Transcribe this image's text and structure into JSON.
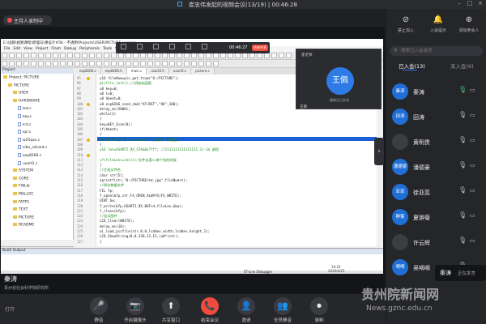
{
  "window": {
    "title": "崔忠伟发起的视频会议(13/19)  |  00:46:28"
  },
  "recording": {
    "label": "主持人录制中"
  },
  "ide": {
    "title": "E:\\试题\\视频课程\\原理与\\课设计#56 - 不透明\\Projects\\USER\\PICTURE.uvprojx",
    "menu": [
      "File",
      "Edit",
      "View",
      "Project",
      "Flash",
      "Debug",
      "Peripherals",
      "Tools",
      "SVCS",
      "Window",
      "Help"
    ],
    "project_header": "Project",
    "tree": [
      {
        "label": "Project: PICTURE",
        "kind": "folder",
        "indent": 0
      },
      {
        "label": "PICTURE",
        "kind": "folder",
        "indent": 1
      },
      {
        "label": "USER",
        "kind": "folder",
        "indent": 2
      },
      {
        "label": "HARDWARE",
        "kind": "folder",
        "indent": 2
      },
      {
        "label": "led.c",
        "kind": "file",
        "indent": 3
      },
      {
        "label": "key.c",
        "kind": "file",
        "indent": 3
      },
      {
        "label": "lcd.c",
        "kind": "file",
        "indent": 3
      },
      {
        "label": "spi.c",
        "kind": "file",
        "indent": 3
      },
      {
        "label": "w25qxx.c",
        "kind": "file",
        "indent": 3
      },
      {
        "label": "sdio_sdcard.c",
        "kind": "file",
        "indent": 3
      },
      {
        "label": "esp8266.c",
        "kind": "file",
        "indent": 3
      },
      {
        "label": "usart2.c",
        "kind": "file",
        "indent": 3
      },
      {
        "label": "SYSTEM",
        "kind": "folder",
        "indent": 2
      },
      {
        "label": "CORE",
        "kind": "folder",
        "indent": 2
      },
      {
        "label": "FWLib",
        "kind": "folder",
        "indent": 2
      },
      {
        "label": "MALLOC",
        "kind": "folder",
        "indent": 2
      },
      {
        "label": "FATFS",
        "kind": "folder",
        "indent": 2
      },
      {
        "label": "TEXT",
        "kind": "folder",
        "indent": 2
      },
      {
        "label": "PICTURE",
        "kind": "folder",
        "indent": 2
      },
      {
        "label": "README",
        "kind": "folder",
        "indent": 2
      }
    ],
    "doc_tabs": [
      "esp8266.c",
      "esp8266.h",
      "main.c",
      "usart2.h",
      "usart2.c",
      "picture.c"
    ],
    "line_numbers": [
      "95",
      "96",
      "97",
      "98",
      "99",
      "100",
      "101",
      "102",
      "103",
      "104",
      "105",
      "106",
      "107",
      "108",
      "109",
      "110",
      "111",
      "112",
      "113",
      "114",
      "115",
      "116",
      "117",
      "118",
      "119",
      "120",
      "121",
      "122",
      "123",
      "124",
      "125",
      "126",
      "127"
    ],
    "code": [
      "u16 fileNum=pic_get_tnum(\"0:/PICTURE\");",
      "picfile_init();//初始化画图",
      "u8 key=0;",
      "u8 t=0;",
      "u8 hbeat=0;",
      "u8 esp8266_send_cmd(\"AT+RST\",\"OK\",100);",
      "delay_ms(5000);",
      "while(1)",
      "{",
      "  key=KEY_Scan(0);",
      "  if(hbeat>",
      "  {",
      "    if(USART2_RX_STA&0x8000)//接收到一次数据了",
      "    {",
      "      u16 len=USART2_RX_STA&0x7fff;   //1111111111111111   3)-1Ω 调用",
      "      u32 fileLen=USART2_RX_BUF[0]<<24 | USART2_RX_BUF[1]<<16 | USART2_RX_BUF[2]<<8 | USART2_RX_BUF[3];",
      "      if(fileLen>=len){//文件长度>=单个包的时候",
      "      {",
      "        //生成文件名",
      "        char str[5];",
      "        sprintf(str,\"0:/PICTURE/%d.jpg\",fileNum+t);",
      "        //保存数据文件",
      "        FIL fp;",
      "        f_open(&fp,str,FA_OPEN_ALWAYS|FA_WRITE);",
      "        UINT bw;",
      "        f_write(&fp,USART2_RX_BUF+4,fileLen,&bw);",
      "        f_close(&fp);",
      "        //显示图片",
      "        LCD_Clear(WHITE);",
      "        delay_ms(10);",
      "        ai_load_picfile(str,0,0,lcddev.width,lcddev.height,1);",
      "        LCD_ShowString(0,0,320,12,12,(u8*)str);",
      "      }"
    ],
    "build_header": "Build Output",
    "status": "ST-Link Debugger"
  },
  "float_controls": {
    "time": "00:46:27",
    "end_label": "结束共享"
  },
  "small_video": {
    "top_name": "崔老师",
    "avatar_text": "王佩",
    "caption": "摄像头已关闭",
    "bottom_name": "王佩"
  },
  "speaker": {
    "name": "秦涛",
    "subtitle": "贵州省社会科学院研究所"
  },
  "mic_mini": "打开",
  "taskbar_clock": {
    "time": "14:22",
    "date": "2020/4/25"
  },
  "bottom_bar": [
    {
      "id": "mute",
      "icon": "🎤",
      "label": "静音",
      "red": false
    },
    {
      "id": "camera",
      "icon": "📷",
      "label": "开启摄像头",
      "red": false
    },
    {
      "id": "share",
      "icon": "⬆",
      "label": "共享窗口",
      "red": false
    },
    {
      "id": "end",
      "icon": "📞",
      "label": "结束会议",
      "red": true
    },
    {
      "id": "manage",
      "icon": "👤",
      "label": "邀请",
      "red": false
    },
    {
      "id": "muteall",
      "icon": "👥",
      "label": "全员静音",
      "red": false
    },
    {
      "id": "record",
      "icon": "⏺",
      "label": "录制",
      "red": false
    }
  ],
  "right_panel": {
    "top_actions": [
      {
        "label": "禁止加入",
        "icon": "⊘"
      },
      {
        "label": "入会提示",
        "icon": "🔔"
      },
      {
        "label": "添加参会人",
        "icon": "⊕"
      }
    ],
    "search_placeholder": "搜索已入会成员",
    "tabs": {
      "joined": "已入会(13)",
      "not_joined": "未入会(6)"
    },
    "members": [
      {
        "name": "秦涛",
        "avatar": "秦涛",
        "color": "#1f6fd6",
        "mic": true
      },
      {
        "name": "田涛",
        "avatar": "田涛",
        "color": "#1f6fd6",
        "mic": false
      },
      {
        "name": "黄明贵",
        "avatar": "",
        "color": "#3b3d42",
        "mic": false
      },
      {
        "name": "潘德豪",
        "avatar": "潘德豪",
        "color": "#1f6fd6",
        "mic": false
      },
      {
        "name": "徐亚蕊",
        "avatar": "亚蕊",
        "color": "#1f6fd6",
        "mic": false
      },
      {
        "name": "夏翀菊",
        "avatar": "翀菊",
        "color": "#1f6fd6",
        "mic": false
      },
      {
        "name": "许云辉",
        "avatar": "",
        "color": "#3b3d42",
        "mic": false
      },
      {
        "name": "吴嘀嘀",
        "avatar": "嘀嘀",
        "color": "#1f6fd6",
        "mic": false
      }
    ],
    "speaking_badge": {
      "name": "秦涛",
      "status": "正在发言"
    }
  },
  "watermark": {
    "text": "贵州院新闻网",
    "url": "News.gznc.edu.cn"
  },
  "colors": {
    "accent": "#2e7be6",
    "danger": "#f24b3d",
    "panel": "#25262a"
  }
}
